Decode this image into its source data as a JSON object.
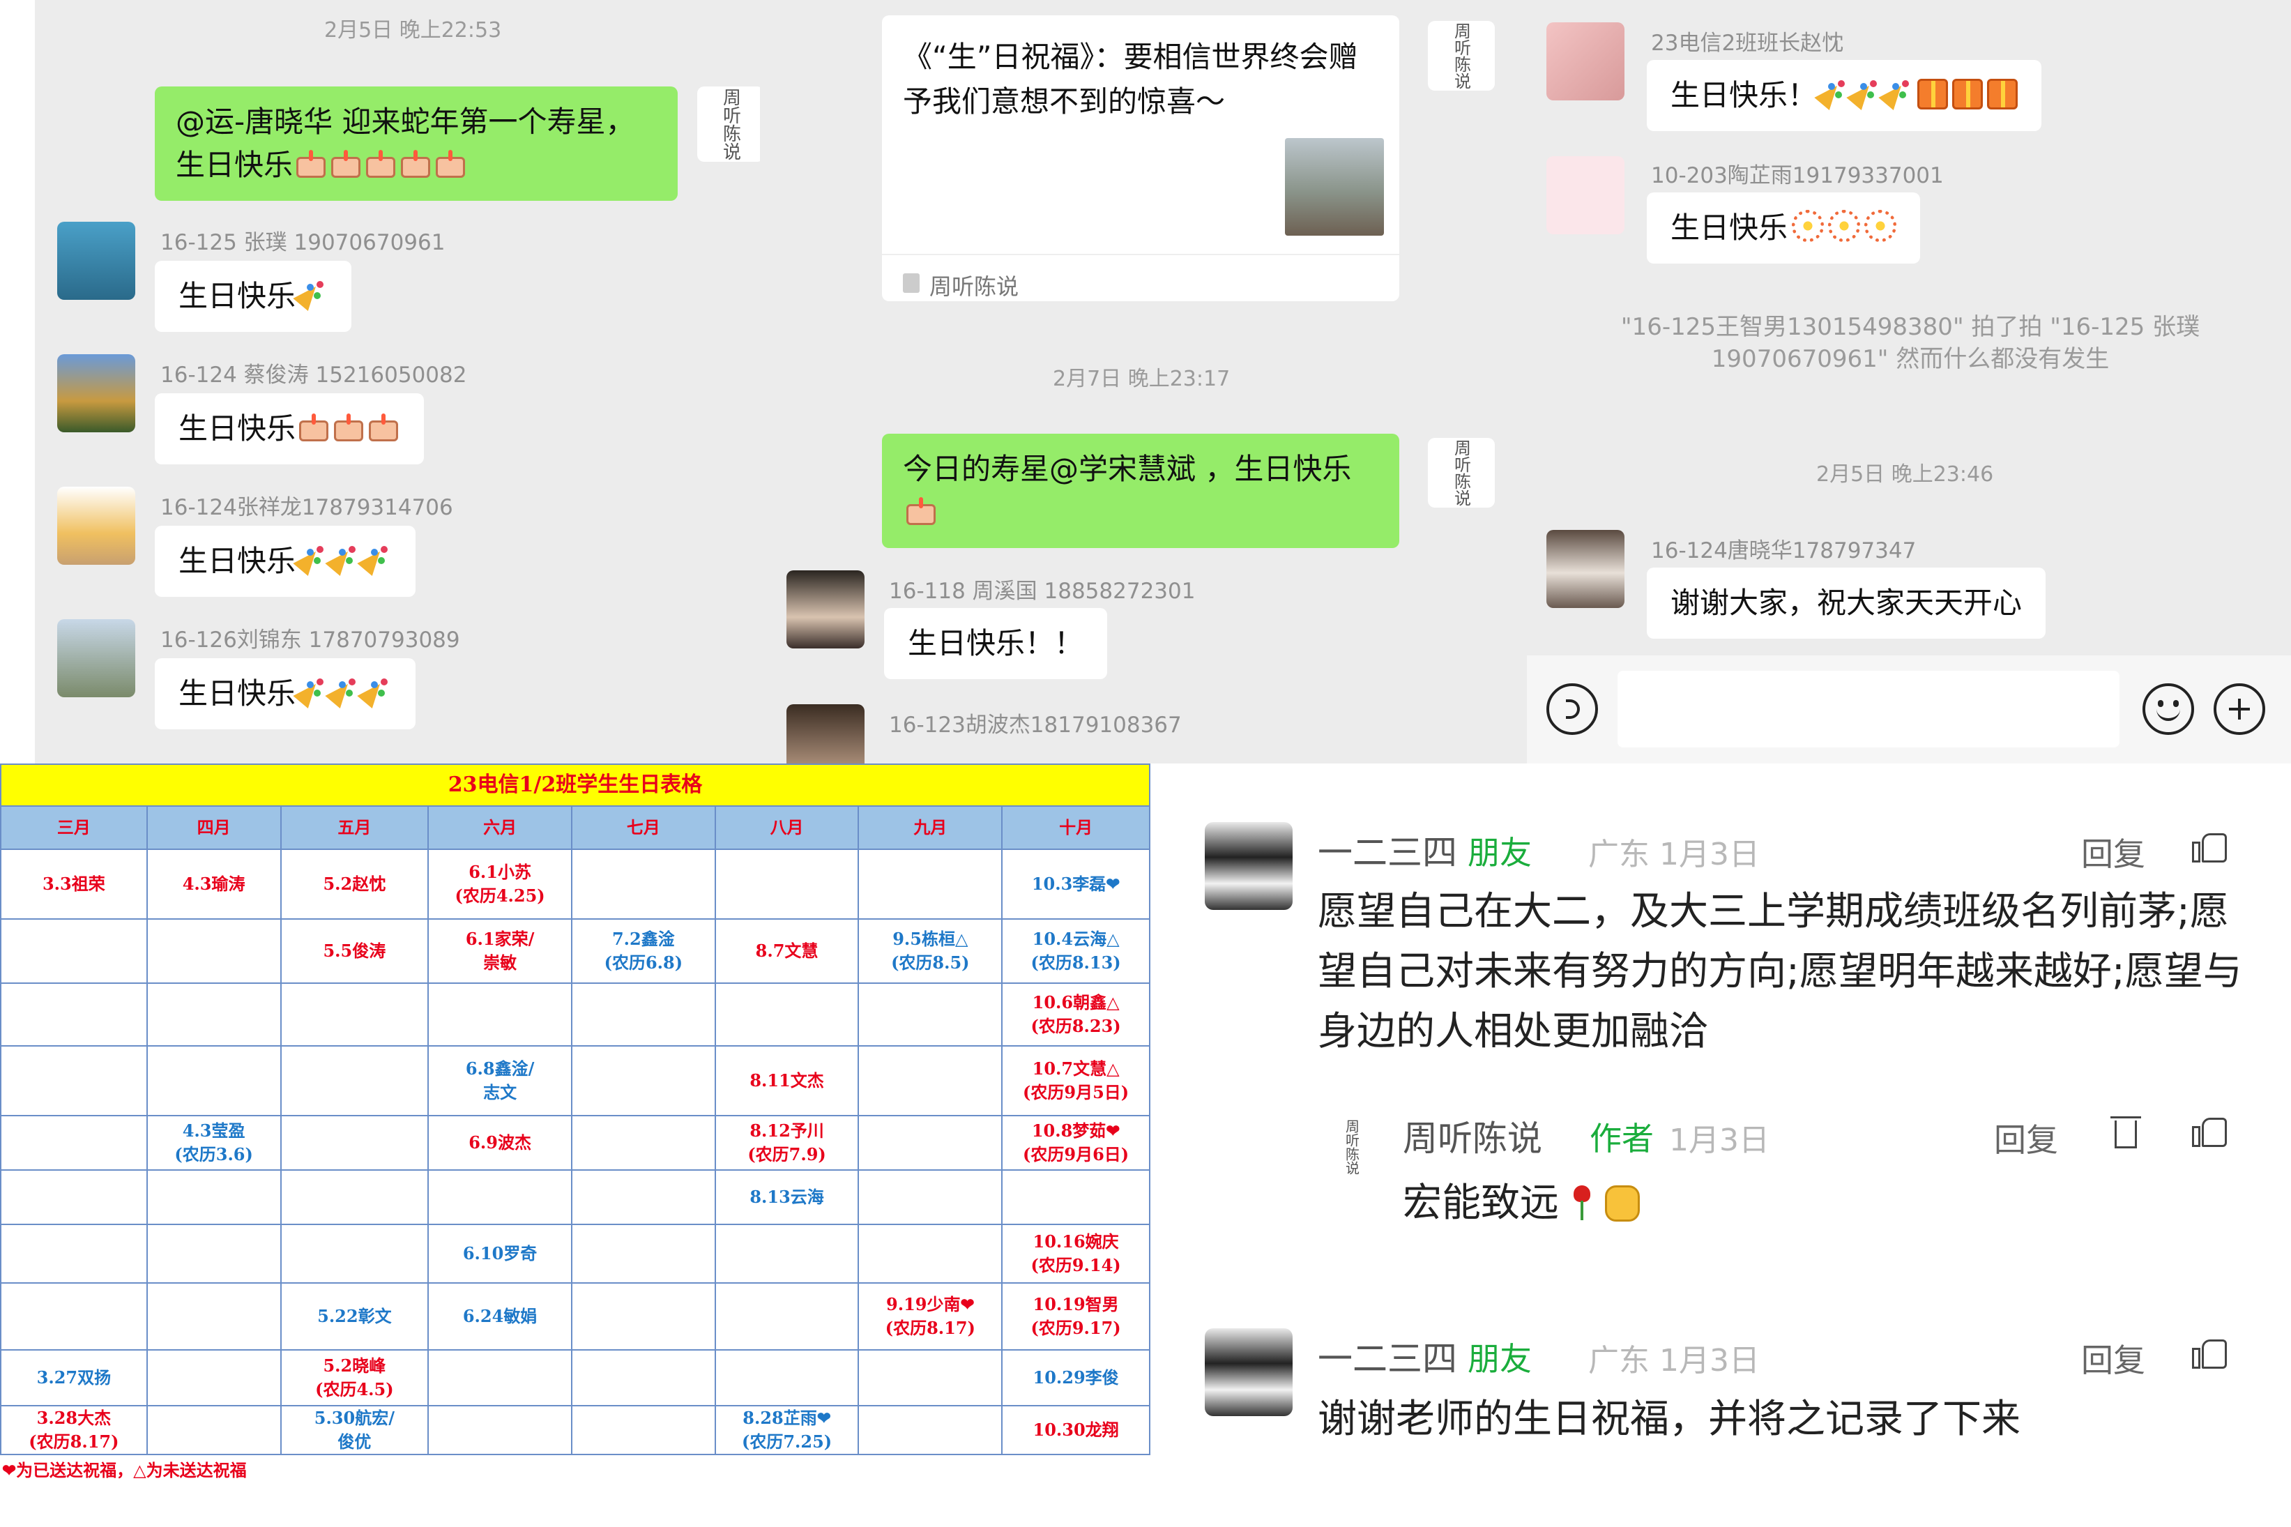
{
  "panel1": {
    "timestamp": "2月5日 晚上22:53",
    "host_message": "@运-唐晓华  迎来蛇年第一个寿星，生日快乐",
    "host_logo": "周听陈说",
    "messages": [
      {
        "user": "16-125 张璞 19070670961",
        "text": "生日快乐",
        "emoji": [
          "party"
        ]
      },
      {
        "user": "16-124 蔡俊涛 15216050082",
        "text": "生日快乐",
        "emoji": [
          "cake",
          "cake",
          "cake"
        ]
      },
      {
        "user": "16-124张祥龙17879314706",
        "text": "生日快乐",
        "emoji": [
          "party",
          "party",
          "party"
        ]
      },
      {
        "user": "16-126刘锦东 17870793089",
        "text": "生日快乐",
        "emoji": [
          "party",
          "party",
          "party"
        ]
      }
    ]
  },
  "panel2": {
    "link_title": "《“生”日祝福》：要相信世界终会赠予我们意想不到的惊喜～",
    "link_source": "周听陈说",
    "timestamp": "2月7日 晚上23:17",
    "host_message": "今日的寿星@学宋慧斌 ，生日快乐",
    "reply_user": "16-118 周溪国 18858272301",
    "reply_text": "生日快乐！！",
    "next_user": "16-123胡波杰18179108367"
  },
  "panel3": {
    "msg1_user": "23电信2班班长赵忱",
    "msg1_text": "生日快乐！",
    "msg2_user": "10-203陶芷雨19179337001",
    "msg2_text": "生日快乐",
    "system_note": "\"16-125王智男13015498380\" 拍了拍 \"16-125 张璞19070670961\" 然而什么都没有发生",
    "timestamp": "2月5日 晚上23:46",
    "msg3_user": "16-124唐晓华178797347",
    "msg3_text": "谢谢大家，祝大家天天开心"
  },
  "table": {
    "title": "23电信1/2班学生生日表格",
    "months": [
      "三月",
      "四月",
      "五月",
      "六月",
      "七月",
      "八月",
      "九月",
      "十月"
    ],
    "rows": [
      [
        [
          "3.3祖荣",
          "r"
        ],
        [
          "4.3瑜涛",
          "r"
        ],
        [
          "5.2赵忱",
          "r"
        ],
        [
          "6.1小苏\n(农历4.25)",
          "r"
        ],
        [
          "",
          ""
        ],
        [
          "",
          ""
        ],
        [
          "",
          ""
        ],
        [
          "10.3李磊❤",
          "b"
        ]
      ],
      [
        [
          "",
          ""
        ],
        [
          "",
          ""
        ],
        [
          "5.5俊涛",
          "r"
        ],
        [
          "6.1家荣/\n崇敏",
          "r"
        ],
        [
          "7.2鑫淦\n(农历6.8)",
          "b"
        ],
        [
          "8.7文慧",
          "r"
        ],
        [
          "9.5栋桓△\n(农历8.5)",
          "b"
        ],
        [
          "10.4云海△\n(农历8.13)",
          "b"
        ]
      ],
      [
        [
          "",
          ""
        ],
        [
          "",
          ""
        ],
        [
          "",
          ""
        ],
        [
          "",
          ""
        ],
        [
          "",
          ""
        ],
        [
          "",
          ""
        ],
        [
          "",
          ""
        ],
        [
          "10.6朝鑫△\n(农历8.23)",
          "r"
        ]
      ],
      [
        [
          "",
          ""
        ],
        [
          "",
          ""
        ],
        [
          "",
          ""
        ],
        [
          "6.8鑫淦/\n志文",
          "b"
        ],
        [
          "",
          ""
        ],
        [
          "8.11文杰",
          "r"
        ],
        [
          "",
          ""
        ],
        [
          "10.7文慧△\n(农历9月5日)",
          "r"
        ]
      ],
      [
        [
          "",
          ""
        ],
        [
          "4.3莹盈\n(农历3.6)",
          "b"
        ],
        [
          "",
          ""
        ],
        [
          "6.9波杰",
          "r"
        ],
        [
          "",
          ""
        ],
        [
          "8.12予川\n(农历7.9)",
          "r"
        ],
        [
          "",
          ""
        ],
        [
          "10.8梦茹❤\n(农历9月6日)",
          "r"
        ]
      ],
      [
        [
          "",
          ""
        ],
        [
          "",
          ""
        ],
        [
          "",
          ""
        ],
        [
          "",
          ""
        ],
        [
          "",
          ""
        ],
        [
          "8.13云海",
          "b"
        ],
        [
          "",
          ""
        ],
        [
          "",
          ""
        ]
      ],
      [
        [
          "",
          ""
        ],
        [
          "",
          ""
        ],
        [
          "",
          ""
        ],
        [
          "6.10罗奇",
          "b"
        ],
        [
          "",
          ""
        ],
        [
          "",
          ""
        ],
        [
          "",
          ""
        ],
        [
          "10.16婉庆\n(农历9.14)",
          "r"
        ]
      ],
      [
        [
          "",
          ""
        ],
        [
          "",
          ""
        ],
        [
          "5.22彰文",
          "b"
        ],
        [
          "6.24敏娟",
          "b"
        ],
        [
          "",
          ""
        ],
        [
          "",
          ""
        ],
        [
          "9.19少南❤\n(农历8.17)",
          "r"
        ],
        [
          "10.19智男\n(农历9.17)",
          "r"
        ]
      ],
      [
        [
          "3.27双扬",
          "b"
        ],
        [
          "",
          ""
        ],
        [
          "5.2晓峰\n(农历4.5)",
          "r"
        ],
        [
          "",
          ""
        ],
        [
          "",
          ""
        ],
        [
          "",
          ""
        ],
        [
          "",
          ""
        ],
        [
          "10.29李俊",
          "b"
        ]
      ],
      [
        [
          "3.28大杰\n(农历8.17)",
          "r"
        ],
        [
          "",
          ""
        ],
        [
          "5.30航宏/\n俊优",
          "b"
        ],
        [
          "",
          ""
        ],
        [
          "",
          ""
        ],
        [
          "8.28芷雨❤\n(农历7.25)",
          "b"
        ],
        [
          "",
          ""
        ],
        [
          "10.30龙翔",
          "r"
        ]
      ]
    ],
    "footnote": "❤为已送达祝福，△为未送达祝福"
  },
  "comments": {
    "c1_name": "一二三四",
    "c1_tag": "朋友",
    "c1_meta": "广东  1月3日",
    "c1_text": "愿望自己在大二，及大三上学期成绩班级名列前茅;愿望自己对未来有努力的方向;愿望明年越来越好;愿望与身边的人相处更加融洽",
    "reply_label": "回复",
    "r_name": "周听陈说",
    "r_tag": "作者",
    "r_meta": "1月3日",
    "r_text": "宏能致远",
    "c2_name": "一二三四",
    "c2_tag": "朋友",
    "c2_meta": "广东  1月3日",
    "c2_text": "谢谢老师的生日祝福，并将之记录了下来"
  },
  "colors": {
    "wechat_green": "#95ec69",
    "table_header": "#ffff00",
    "month_row": "#9dc3e6",
    "red_text": "#e8001b",
    "blue_text": "#1e78c8",
    "tag_green": "#1aad3c"
  }
}
